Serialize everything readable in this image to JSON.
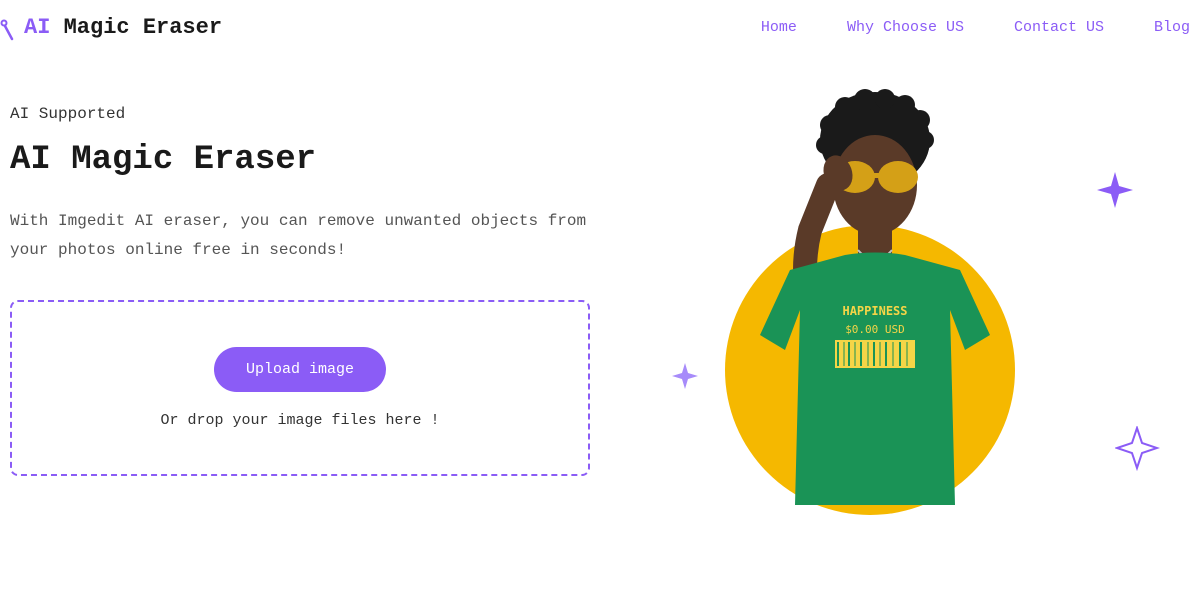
{
  "logo": {
    "ai_text": "AI",
    "rest_text": " Magic Eraser"
  },
  "nav": {
    "items": [
      {
        "label": "Home"
      },
      {
        "label": "Why Choose US"
      },
      {
        "label": "Contact US"
      },
      {
        "label": "Blog"
      }
    ]
  },
  "hero": {
    "supported_label": "AI Supported",
    "title": "AI Magic Eraser",
    "description": "With Imgedit AI eraser, you can remove unwanted objects from your photos online free in seconds!"
  },
  "upload": {
    "button_label": "Upload image",
    "drop_text": "Or drop your image files here !"
  }
}
